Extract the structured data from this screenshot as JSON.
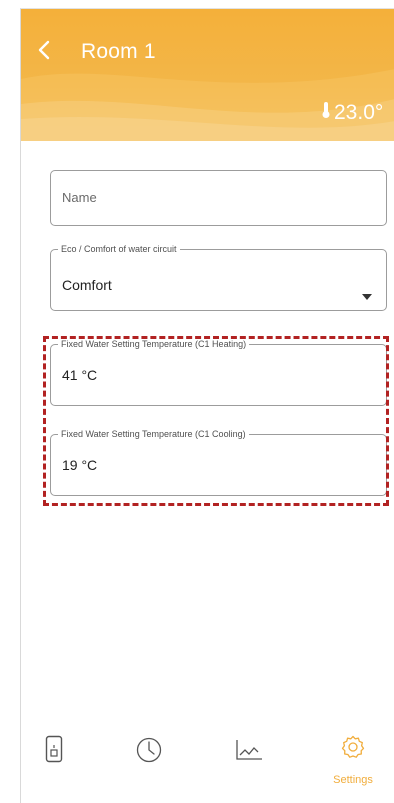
{
  "header": {
    "title": "Room 1",
    "temperature": "23.0°"
  },
  "form": {
    "name": {
      "placeholder": "Name",
      "value": ""
    },
    "eco_comfort": {
      "label": "Eco / Comfort of water circuit",
      "value": "Comfort"
    },
    "heating_temp": {
      "label": "Fixed Water Setting Temperature (C1 Heating)",
      "value": "41 °C"
    },
    "cooling_temp": {
      "label": "Fixed Water Setting Temperature (C1 Cooling)",
      "value": "19 °C"
    }
  },
  "bottom_nav": {
    "items": [
      {
        "icon": "device-icon",
        "label": ""
      },
      {
        "icon": "clock-icon",
        "label": ""
      },
      {
        "icon": "chart-icon",
        "label": ""
      },
      {
        "icon": "gear-icon",
        "label": "Settings",
        "active": true
      }
    ]
  },
  "colors": {
    "accent": "#f1ad3c",
    "header": "#f4b03a",
    "highlight": "#b22222",
    "icon_gray": "#555555"
  }
}
